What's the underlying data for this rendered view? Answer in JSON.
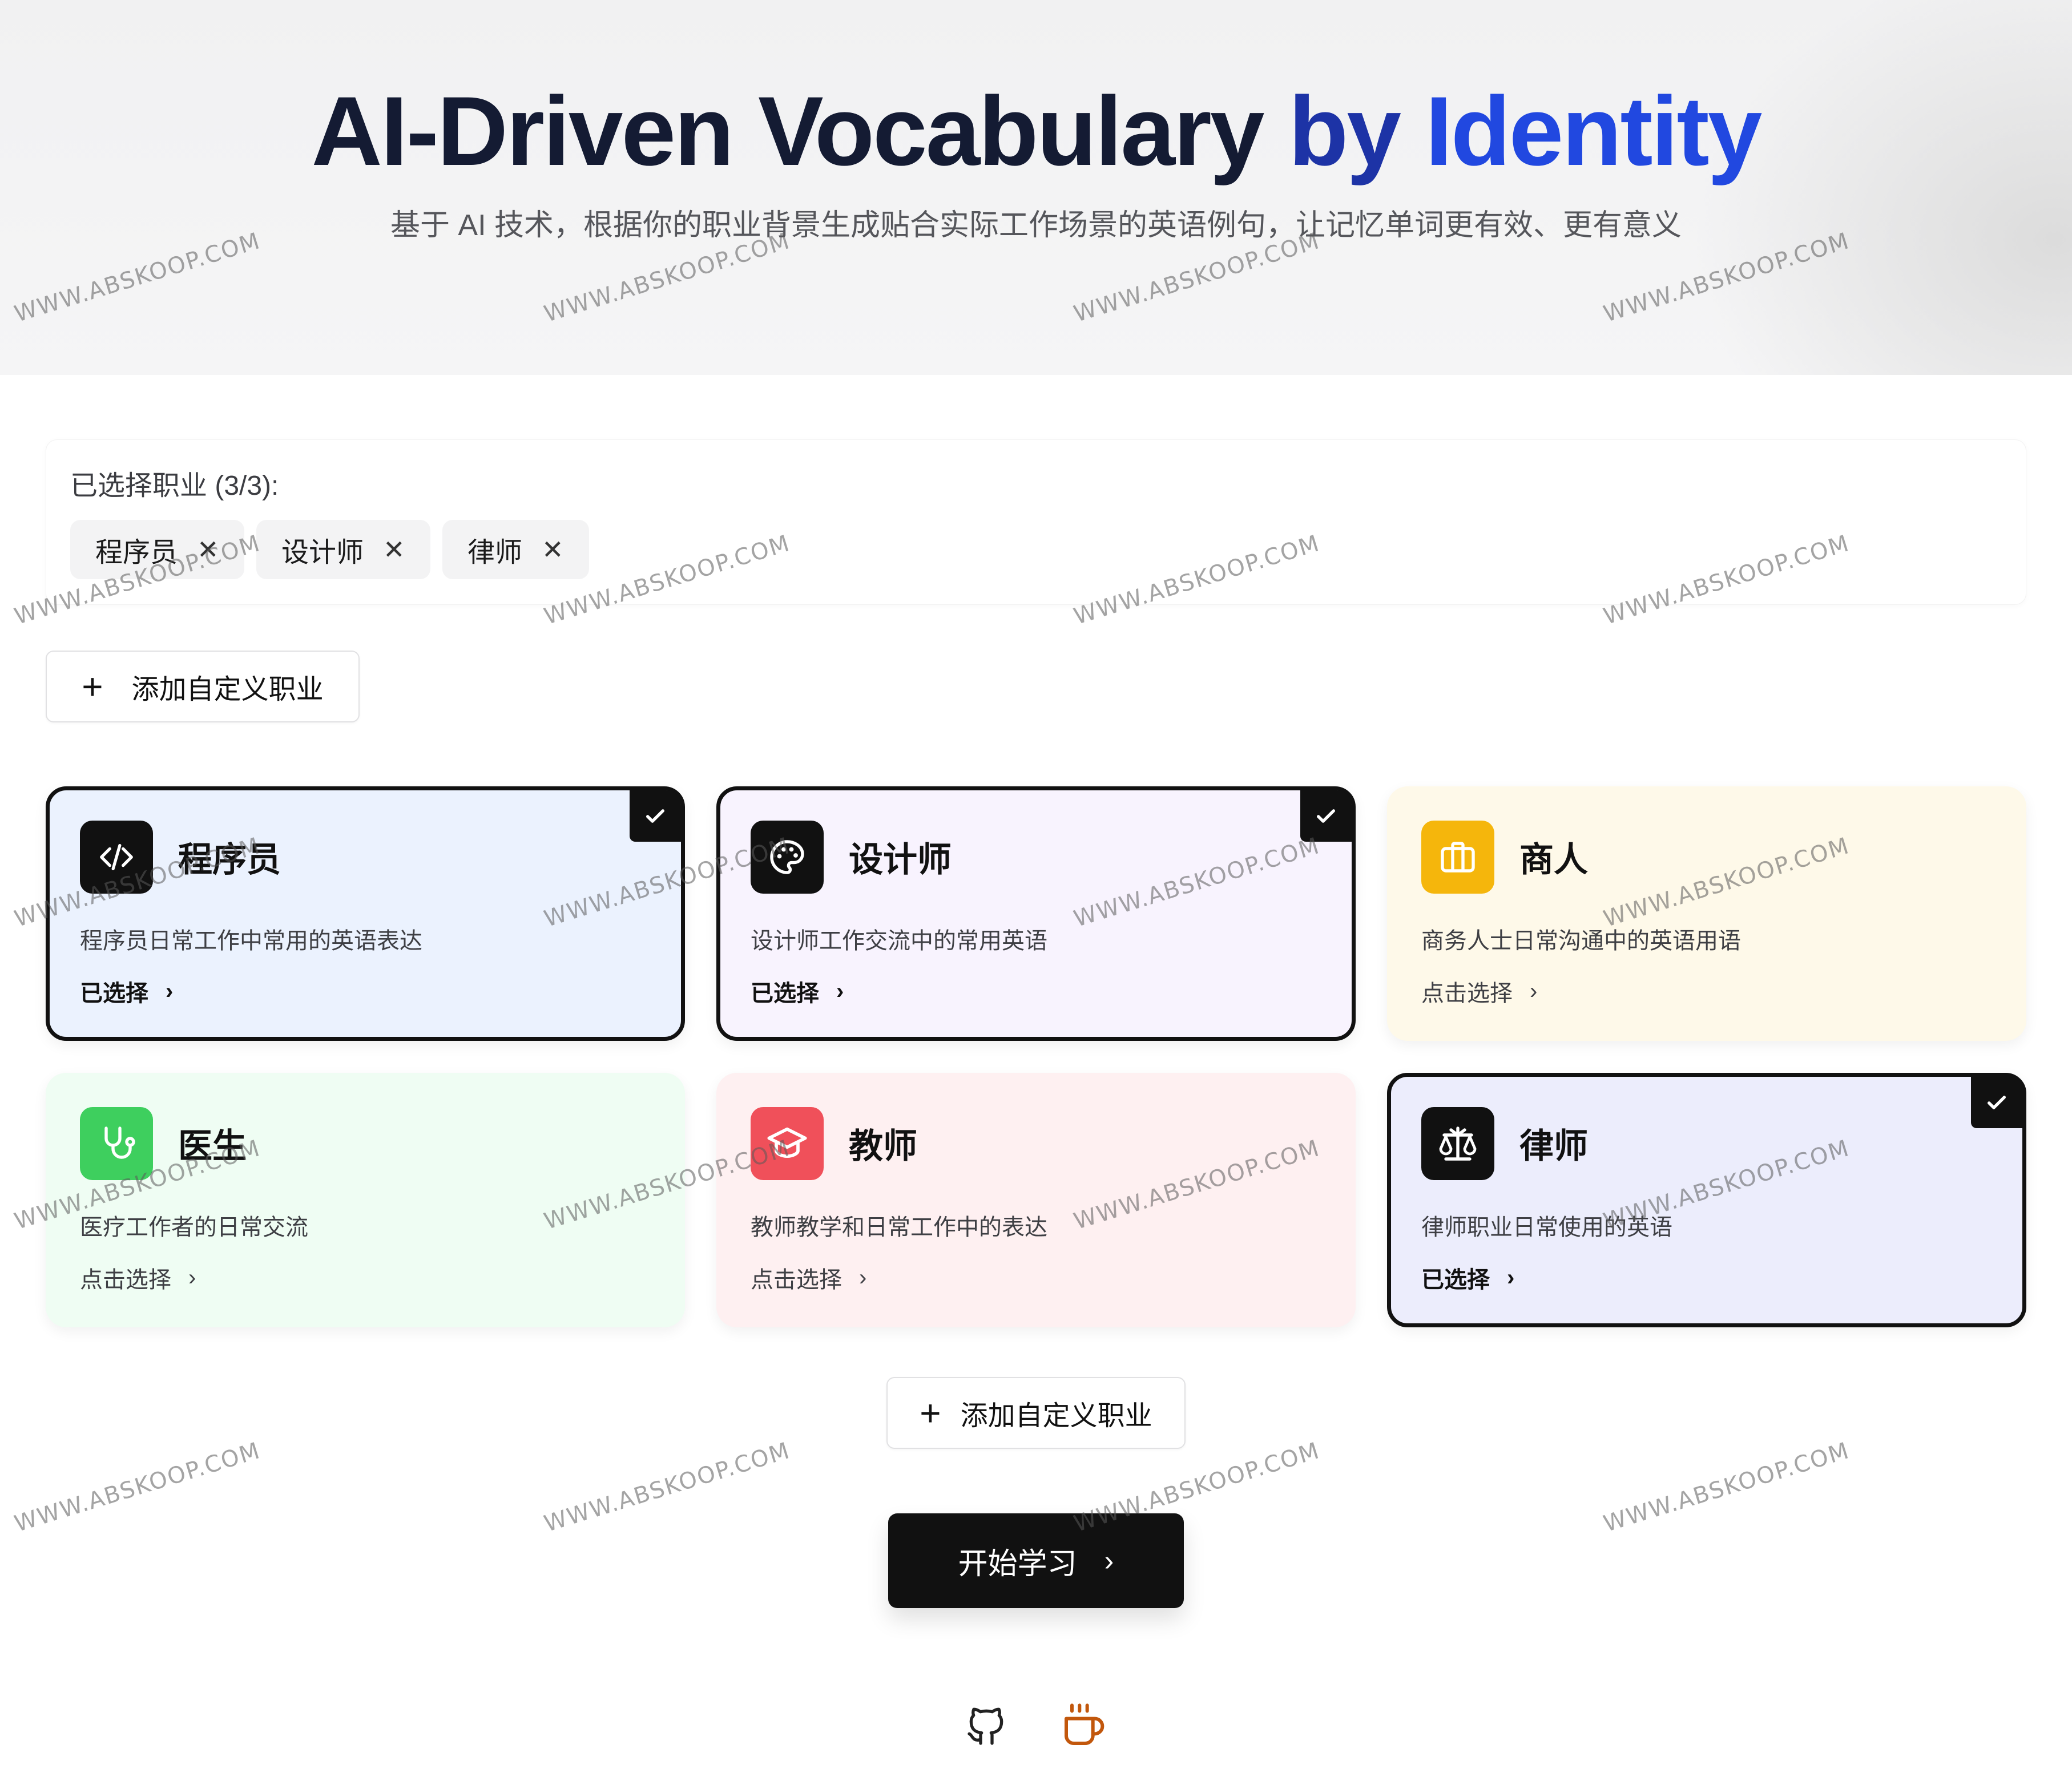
{
  "hero": {
    "title_part1": "AI-Driven Vocabulary ",
    "title_part2": "by ",
    "title_part3": "Identity",
    "subtitle": "基于 AI 技术，根据你的职业背景生成贴合实际工作场景的英语例句，让记忆单词更有效、更有意义"
  },
  "selected": {
    "label": "已选择职业 (3/3):",
    "chips": [
      {
        "label": "程序员",
        "remove_icon": "close-icon"
      },
      {
        "label": "设计师",
        "remove_icon": "close-icon"
      },
      {
        "label": "律师",
        "remove_icon": "close-icon"
      }
    ]
  },
  "add_custom": {
    "label": "添加自定义职业",
    "icon": "plus-icon"
  },
  "cards": [
    {
      "title": "程序员",
      "desc": "程序员日常工作中常用的英语表达",
      "action": "已选择",
      "selected": true,
      "icon": "code-icon",
      "icon_bg": "#111111",
      "bg": "#ebf2fe"
    },
    {
      "title": "设计师",
      "desc": "设计师工作交流中的常用英语",
      "action": "已选择",
      "selected": true,
      "icon": "palette-icon",
      "icon_bg": "#111111",
      "bg": "#f8f3fe"
    },
    {
      "title": "商人",
      "desc": "商务人士日常沟通中的英语用语",
      "action": "点击选择",
      "selected": false,
      "icon": "briefcase-icon",
      "icon_bg": "#f5b60c",
      "bg": "#fef9e9"
    },
    {
      "title": "医生",
      "desc": "医疗工作者的日常交流",
      "action": "点击选择",
      "selected": false,
      "icon": "stethoscope-icon",
      "icon_bg": "#3ecf5e",
      "bg": "#effdf3"
    },
    {
      "title": "教师",
      "desc": "教师教学和日常工作中的表达",
      "action": "点击选择",
      "selected": false,
      "icon": "graduation-cap-icon",
      "icon_bg": "#f0505a",
      "bg": "#fef0f1"
    },
    {
      "title": "律师",
      "desc": "律师职业日常使用的英语",
      "action": "已选择",
      "selected": true,
      "icon": "scale-icon",
      "icon_bg": "#111111",
      "bg": "#ecedfc"
    }
  ],
  "start": {
    "label": "开始学习"
  },
  "footer": {
    "icons": [
      "github-icon",
      "coffee-icon"
    ],
    "coffee_color": "#c2570c"
  },
  "watermark": "WWW.ABSKOOP.COM"
}
